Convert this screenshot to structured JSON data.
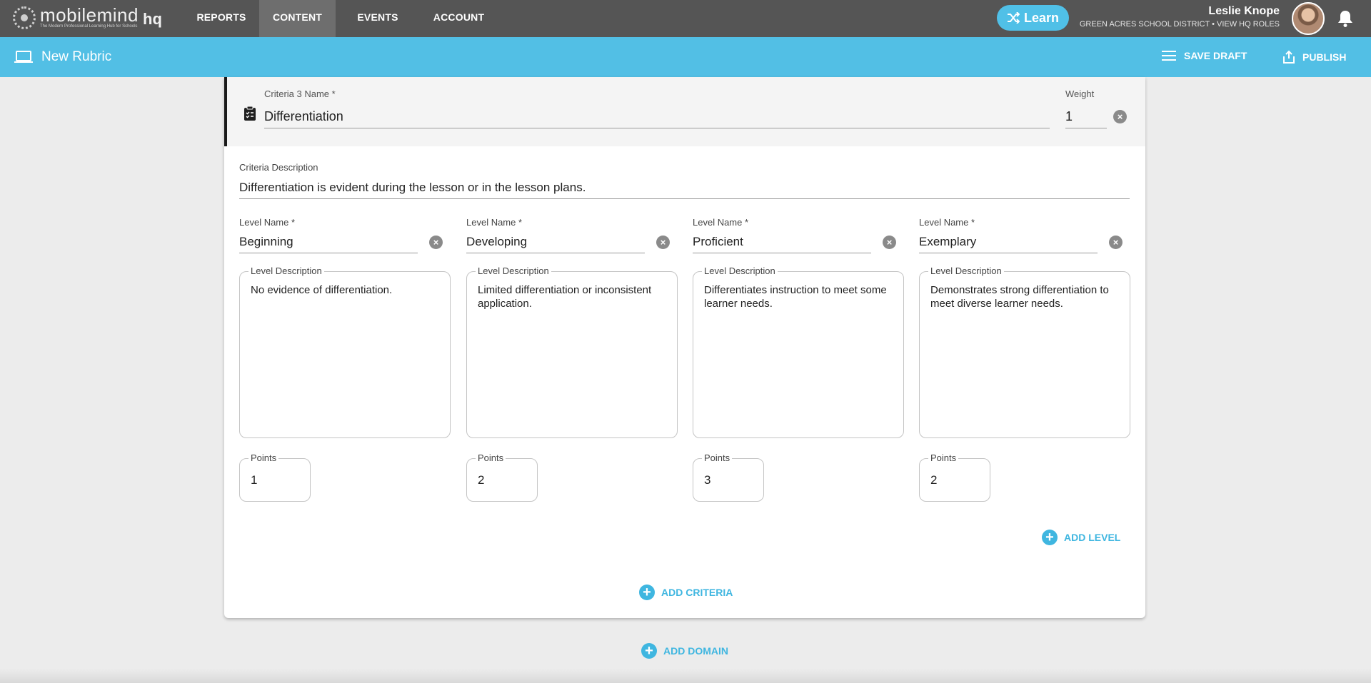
{
  "brand": {
    "name": "mobilemind",
    "tagline": "The Modern Professional Learning Hub for Schools",
    "suffix": "hq"
  },
  "nav": {
    "reports": "REPORTS",
    "content": "CONTENT",
    "events": "EVENTS",
    "account": "ACCOUNT"
  },
  "learn_button": "Learn",
  "user": {
    "name": "Leslie Knope",
    "subtitle": "GREEN ACRES SCHOOL DISTRICT • VIEW HQ ROLES"
  },
  "subheader": {
    "title": "New Rubric",
    "save_draft": "SAVE DRAFT",
    "publish": "PUBLISH"
  },
  "criteria": {
    "name_label": "Criteria 3 Name *",
    "name_value": "Differentiation",
    "weight_label": "Weight",
    "weight_value": "1",
    "description_label": "Criteria Description",
    "description_value": "Differentiation is evident during the lesson or in the lesson plans."
  },
  "levels": [
    {
      "name_label": "Level Name *",
      "name": "Beginning",
      "desc_label": "Level Description",
      "description": "No evidence of differentiation.",
      "points_label": "Points",
      "points": "1"
    },
    {
      "name_label": "Level Name *",
      "name": "Developing",
      "desc_label": "Level Description",
      "description": "Limited differentiation or inconsistent application.",
      "points_label": "Points",
      "points": "2"
    },
    {
      "name_label": "Level Name *",
      "name": "Proficient",
      "desc_label": "Level Description",
      "description": "Differentiates instruction to meet some learner needs.",
      "points_label": "Points",
      "points": "3"
    },
    {
      "name_label": "Level Name *",
      "name": "Exemplary",
      "desc_label": "Level Description",
      "description": "Demonstrates strong differentiation to meet diverse learner needs.",
      "points_label": "Points",
      "points": "2"
    }
  ],
  "actions": {
    "add_level": "ADD LEVEL",
    "add_criteria": "ADD CRITERIA",
    "add_domain": "ADD DOMAIN"
  },
  "colors": {
    "nav_bg": "#555555",
    "accent": "#52bfe5",
    "link": "#3fb6e0"
  }
}
